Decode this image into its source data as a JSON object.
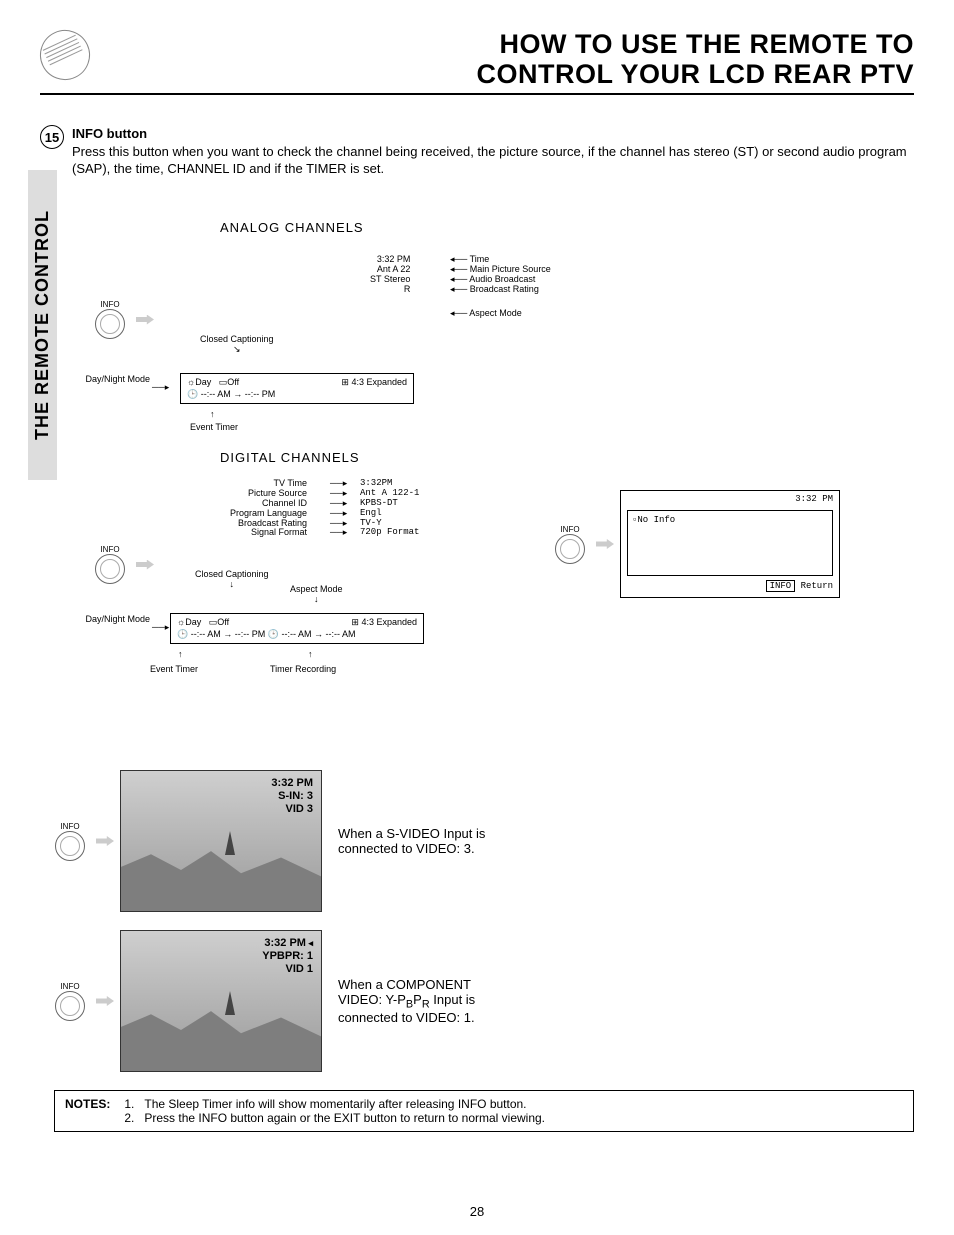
{
  "header": {
    "title_line1": "HOW TO USE THE REMOTE TO",
    "title_line2": "CONTROL YOUR LCD REAR PTV"
  },
  "side_tab": "THE REMOTE CONTROL",
  "section": {
    "num": "15",
    "title": "INFO button",
    "body": "Press this button when you want to check the channel being received, the picture source, if the channel has stereo (ST) or second audio program (SAP), the time, CHANNEL ID and if the TIMER is set."
  },
  "info_btn_label": "INFO",
  "analog": {
    "heading": "ANALOG CHANNELS",
    "osd": {
      "time": "3:32 PM",
      "source": "Ant A 22",
      "audio": "ST Stereo",
      "rating": "R"
    },
    "labels": {
      "time": "Time",
      "main_source": "Main Picture Source",
      "audio": "Audio Broadcast",
      "rating": "Broadcast Rating",
      "aspect": "Aspect Mode",
      "cc": "Closed Captioning",
      "daynight": "Day/Night Mode",
      "event_timer": "Event Timer"
    },
    "bottom_box": {
      "day": "Day",
      "cc_state": "Off",
      "aspect": "4:3 Expanded",
      "timer": "--:-- AM → --:-- PM"
    }
  },
  "digital": {
    "heading": "DIGITAL CHANNELS",
    "labels": {
      "tv_time": "TV Time",
      "picture_source": "Picture Source",
      "channel_id": "Channel ID",
      "program_language": "Program Language",
      "broadcast_rating": "Broadcast Rating",
      "signal_format": "Signal Format",
      "cc": "Closed Captioning",
      "aspect": "Aspect Mode",
      "daynight": "Day/Night Mode",
      "event_timer": "Event Timer",
      "timer_recording": "Timer Recording"
    },
    "osd": {
      "time": "3:32PM",
      "source": "Ant A 122-1",
      "chan_id": "KPBS-DT",
      "lang": "Engl",
      "rating": "TV-Y",
      "sig": "720p Format"
    },
    "bottom_box": {
      "day": "Day",
      "cc_state": "Off",
      "aspect": "4:3 Expanded",
      "timer1": "--:-- AM → --:-- PM",
      "timer2": "--:-- AM → --:-- AM"
    }
  },
  "noinfo": {
    "time": "3:32 PM",
    "text": "No Info",
    "btn1": "INFO",
    "btn2": "Return"
  },
  "svideo": {
    "overlay": {
      "time": "3:32 PM",
      "line2": "S-IN: 3",
      "line3": "VID 3"
    },
    "caption": "When a S-VIDEO Input is connected to VIDEO: 3."
  },
  "ypbpr": {
    "overlay": {
      "time": "3:32 PM",
      "line2": "YPBPR: 1",
      "line3": "VID 1"
    },
    "caption_pre": "When a COMPONENT VIDEO: Y-P",
    "caption_b": "B",
    "caption_mid": "P",
    "caption_r": "R",
    "caption_post": " Input is connected to VIDEO: 1."
  },
  "notes": {
    "label": "NOTES:",
    "items": [
      "The Sleep Timer info will show momentarily after releasing INFO button.",
      "Press the INFO button again or the EXIT button to return to normal viewing."
    ]
  },
  "page_number": "28"
}
